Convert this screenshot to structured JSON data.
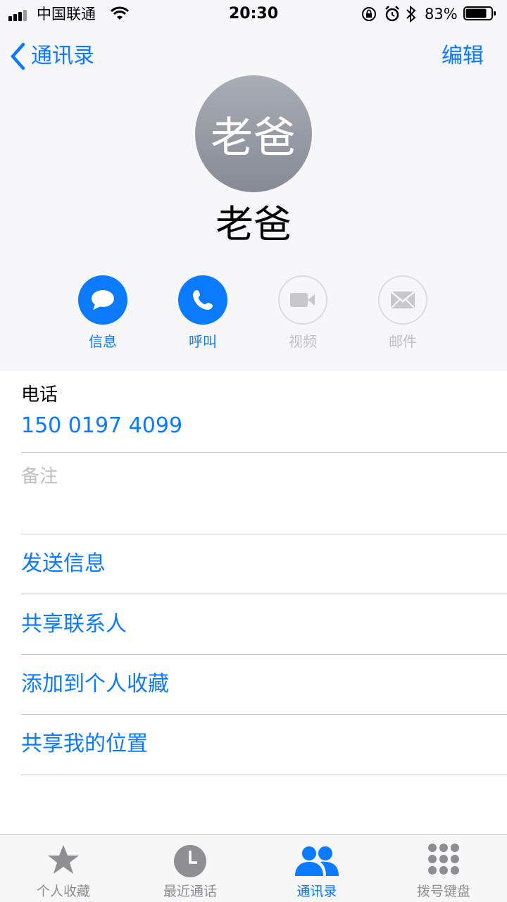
{
  "status_bar": {
    "carrier": "中国联通",
    "time": "20:30",
    "battery": "83%",
    "battery_level": 0.83
  },
  "nav": {
    "back_label": "通讯录",
    "edit_label": "编辑"
  },
  "contact": {
    "avatar_text": "老爸",
    "name": "老爸"
  },
  "actions": [
    {
      "label": "信息",
      "icon": "message-icon",
      "enabled": true
    },
    {
      "label": "呼叫",
      "icon": "phone-icon",
      "enabled": true
    },
    {
      "label": "视频",
      "icon": "video-icon",
      "enabled": false
    },
    {
      "label": "邮件",
      "icon": "mail-icon",
      "enabled": false
    }
  ],
  "details": {
    "phone_label": "电话",
    "phone_number": "150 0197 4099",
    "notes_label": "备注"
  },
  "links": [
    {
      "label": "发送信息"
    },
    {
      "label": "共享联系人"
    },
    {
      "label": "添加到个人收藏"
    },
    {
      "label": "共享我的位置"
    }
  ],
  "tabs": [
    {
      "label": "个人收藏",
      "icon": "star-icon",
      "active": false
    },
    {
      "label": "最近通话",
      "icon": "clock-icon",
      "active": false
    },
    {
      "label": "通讯录",
      "icon": "contacts-icon",
      "active": true
    },
    {
      "label": "拨号键盘",
      "icon": "keypad-icon",
      "active": false
    }
  ],
  "colors": {
    "accent": "#0a7aff",
    "disabled": "#c0c0c4",
    "inactive_tab": "#8e8e93"
  }
}
